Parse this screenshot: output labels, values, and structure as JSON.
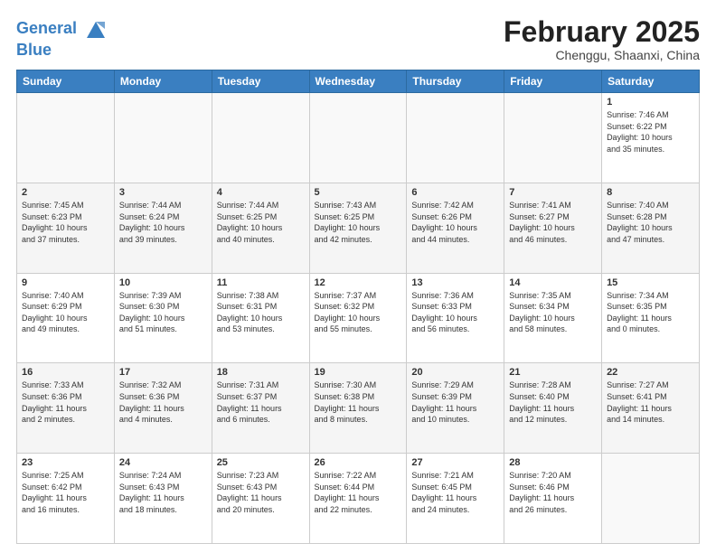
{
  "header": {
    "logo_line1": "General",
    "logo_line2": "Blue",
    "month": "February 2025",
    "location": "Chenggu, Shaanxi, China"
  },
  "weekdays": [
    "Sunday",
    "Monday",
    "Tuesday",
    "Wednesday",
    "Thursday",
    "Friday",
    "Saturday"
  ],
  "weeks": [
    [
      {
        "day": "",
        "info": ""
      },
      {
        "day": "",
        "info": ""
      },
      {
        "day": "",
        "info": ""
      },
      {
        "day": "",
        "info": ""
      },
      {
        "day": "",
        "info": ""
      },
      {
        "day": "",
        "info": ""
      },
      {
        "day": "1",
        "info": "Sunrise: 7:46 AM\nSunset: 6:22 PM\nDaylight: 10 hours\nand 35 minutes."
      }
    ],
    [
      {
        "day": "2",
        "info": "Sunrise: 7:45 AM\nSunset: 6:23 PM\nDaylight: 10 hours\nand 37 minutes."
      },
      {
        "day": "3",
        "info": "Sunrise: 7:44 AM\nSunset: 6:24 PM\nDaylight: 10 hours\nand 39 minutes."
      },
      {
        "day": "4",
        "info": "Sunrise: 7:44 AM\nSunset: 6:25 PM\nDaylight: 10 hours\nand 40 minutes."
      },
      {
        "day": "5",
        "info": "Sunrise: 7:43 AM\nSunset: 6:25 PM\nDaylight: 10 hours\nand 42 minutes."
      },
      {
        "day": "6",
        "info": "Sunrise: 7:42 AM\nSunset: 6:26 PM\nDaylight: 10 hours\nand 44 minutes."
      },
      {
        "day": "7",
        "info": "Sunrise: 7:41 AM\nSunset: 6:27 PM\nDaylight: 10 hours\nand 46 minutes."
      },
      {
        "day": "8",
        "info": "Sunrise: 7:40 AM\nSunset: 6:28 PM\nDaylight: 10 hours\nand 47 minutes."
      }
    ],
    [
      {
        "day": "9",
        "info": "Sunrise: 7:40 AM\nSunset: 6:29 PM\nDaylight: 10 hours\nand 49 minutes."
      },
      {
        "day": "10",
        "info": "Sunrise: 7:39 AM\nSunset: 6:30 PM\nDaylight: 10 hours\nand 51 minutes."
      },
      {
        "day": "11",
        "info": "Sunrise: 7:38 AM\nSunset: 6:31 PM\nDaylight: 10 hours\nand 53 minutes."
      },
      {
        "day": "12",
        "info": "Sunrise: 7:37 AM\nSunset: 6:32 PM\nDaylight: 10 hours\nand 55 minutes."
      },
      {
        "day": "13",
        "info": "Sunrise: 7:36 AM\nSunset: 6:33 PM\nDaylight: 10 hours\nand 56 minutes."
      },
      {
        "day": "14",
        "info": "Sunrise: 7:35 AM\nSunset: 6:34 PM\nDaylight: 10 hours\nand 58 minutes."
      },
      {
        "day": "15",
        "info": "Sunrise: 7:34 AM\nSunset: 6:35 PM\nDaylight: 11 hours\nand 0 minutes."
      }
    ],
    [
      {
        "day": "16",
        "info": "Sunrise: 7:33 AM\nSunset: 6:36 PM\nDaylight: 11 hours\nand 2 minutes."
      },
      {
        "day": "17",
        "info": "Sunrise: 7:32 AM\nSunset: 6:36 PM\nDaylight: 11 hours\nand 4 minutes."
      },
      {
        "day": "18",
        "info": "Sunrise: 7:31 AM\nSunset: 6:37 PM\nDaylight: 11 hours\nand 6 minutes."
      },
      {
        "day": "19",
        "info": "Sunrise: 7:30 AM\nSunset: 6:38 PM\nDaylight: 11 hours\nand 8 minutes."
      },
      {
        "day": "20",
        "info": "Sunrise: 7:29 AM\nSunset: 6:39 PM\nDaylight: 11 hours\nand 10 minutes."
      },
      {
        "day": "21",
        "info": "Sunrise: 7:28 AM\nSunset: 6:40 PM\nDaylight: 11 hours\nand 12 minutes."
      },
      {
        "day": "22",
        "info": "Sunrise: 7:27 AM\nSunset: 6:41 PM\nDaylight: 11 hours\nand 14 minutes."
      }
    ],
    [
      {
        "day": "23",
        "info": "Sunrise: 7:25 AM\nSunset: 6:42 PM\nDaylight: 11 hours\nand 16 minutes."
      },
      {
        "day": "24",
        "info": "Sunrise: 7:24 AM\nSunset: 6:43 PM\nDaylight: 11 hours\nand 18 minutes."
      },
      {
        "day": "25",
        "info": "Sunrise: 7:23 AM\nSunset: 6:43 PM\nDaylight: 11 hours\nand 20 minutes."
      },
      {
        "day": "26",
        "info": "Sunrise: 7:22 AM\nSunset: 6:44 PM\nDaylight: 11 hours\nand 22 minutes."
      },
      {
        "day": "27",
        "info": "Sunrise: 7:21 AM\nSunset: 6:45 PM\nDaylight: 11 hours\nand 24 minutes."
      },
      {
        "day": "28",
        "info": "Sunrise: 7:20 AM\nSunset: 6:46 PM\nDaylight: 11 hours\nand 26 minutes."
      },
      {
        "day": "",
        "info": ""
      }
    ]
  ]
}
